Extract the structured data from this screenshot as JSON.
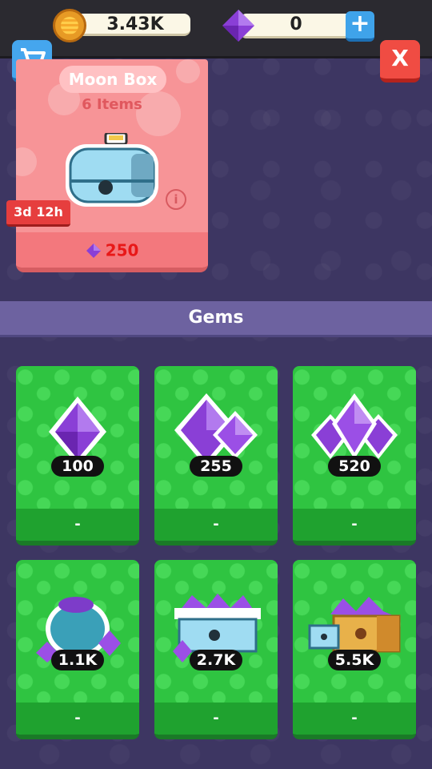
{
  "top_bar": {
    "coins": "3.43K",
    "gems": "0",
    "add_label": "+",
    "close_label": "X"
  },
  "featured": {
    "title": "Moon Box",
    "subtitle": "6 Items",
    "timer": "3d 12h",
    "info_label": "i",
    "price": "250"
  },
  "section": {
    "title": "Gems"
  },
  "gem_packs": [
    {
      "amount": "100",
      "price": "-"
    },
    {
      "amount": "255",
      "price": "-"
    },
    {
      "amount": "520",
      "price": "-"
    },
    {
      "amount": "1.1K",
      "price": "-"
    },
    {
      "amount": "2.7K",
      "price": "-"
    },
    {
      "amount": "5.5K",
      "price": "-"
    }
  ],
  "colors": {
    "background": "#3d3662",
    "gem_card": "#2fc441",
    "featured_card": "#f79497",
    "header": "#6d62a0",
    "price_red": "#e81818"
  },
  "icons": [
    "coin-icon",
    "gem-icon",
    "plus-icon",
    "cart-icon",
    "close-icon",
    "info-icon",
    "chest-icon"
  ]
}
